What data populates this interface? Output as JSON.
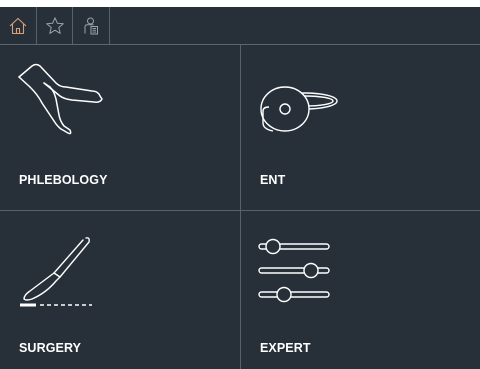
{
  "toolbar": {
    "tabs": [
      {
        "icon": "home-icon",
        "active": true
      },
      {
        "icon": "star-icon",
        "active": false
      },
      {
        "icon": "document-icon",
        "active": false
      }
    ]
  },
  "tiles": [
    {
      "label": "PHLEBOLOGY",
      "icon": "legs-icon"
    },
    {
      "label": "ENT",
      "icon": "head-mirror-icon"
    },
    {
      "label": "SURGERY",
      "icon": "scalpel-icon"
    },
    {
      "label": "EXPERT",
      "icon": "sliders-icon"
    }
  ],
  "colors": {
    "background": "#273039",
    "divider": "#56616c",
    "icon": "#ffffff",
    "active_icon": "#d9a07a"
  }
}
